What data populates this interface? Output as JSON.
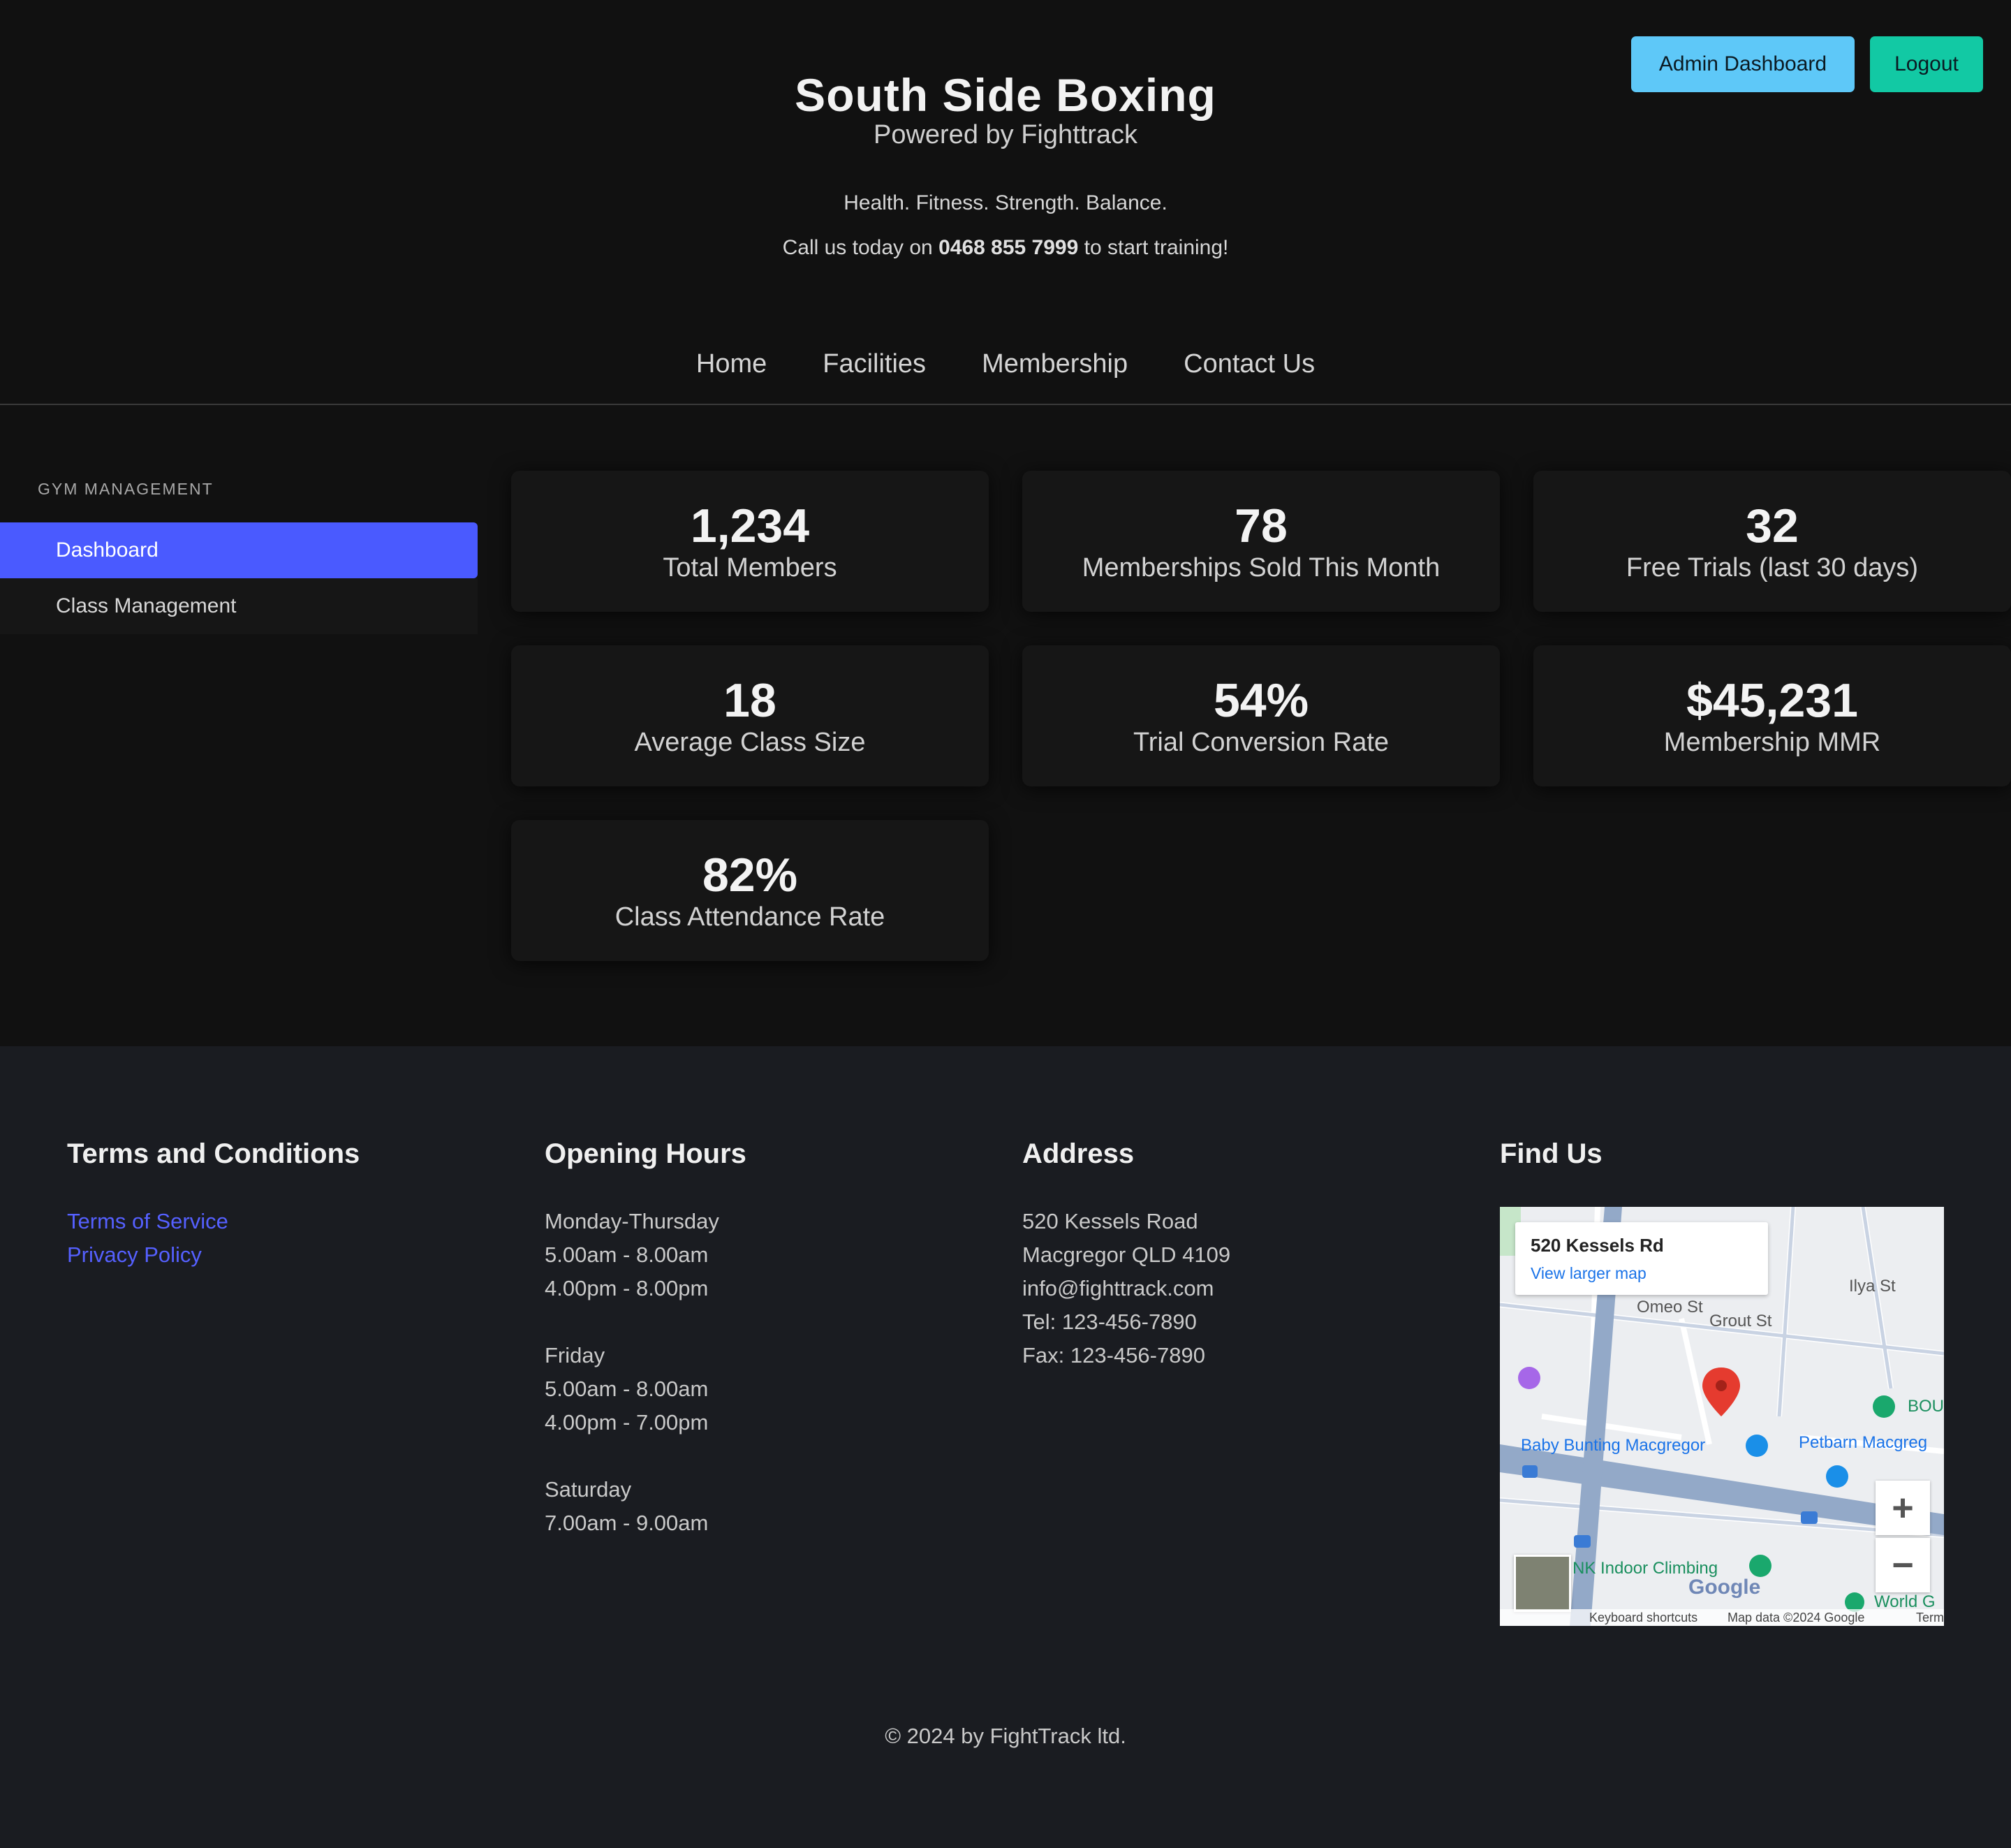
{
  "header": {
    "admin_button": "Admin Dashboard",
    "logout_button": "Logout",
    "title": "South Side Boxing",
    "subtitle": "Powered by Fighttrack",
    "tagline": "Health. Fitness. Strength. Balance.",
    "call_prefix": "Call us today on",
    "phone": "0468 855 7999",
    "call_suffix": "to start training!",
    "accent_admin": "#5ec8f8",
    "accent_logout": "#12c9a4"
  },
  "nav": {
    "items": [
      "Home",
      "Facilities",
      "Membership",
      "Contact Us"
    ]
  },
  "sidebar": {
    "heading": "GYM MANAGEMENT",
    "items": [
      {
        "label": "Dashboard",
        "active": true
      },
      {
        "label": "Class Management",
        "active": false
      }
    ],
    "active_color": "#4a5aff"
  },
  "stats": [
    {
      "value": "1,234",
      "label": "Total Members"
    },
    {
      "value": "78",
      "label": "Memberships Sold This Month"
    },
    {
      "value": "32",
      "label": "Free Trials (last 30 days)"
    },
    {
      "value": "18",
      "label": "Average Class Size"
    },
    {
      "value": "54%",
      "label": "Trial Conversion Rate"
    },
    {
      "value": "$45,231",
      "label": "Membership MMR"
    },
    {
      "value": "82%",
      "label": "Class Attendance Rate"
    }
  ],
  "footer": {
    "terms": {
      "heading": "Terms and Conditions",
      "links": [
        "Terms of Service",
        "Privacy Policy"
      ]
    },
    "hours": {
      "heading": "Opening Hours",
      "groups": [
        {
          "day": "Monday-Thursday",
          "times": [
            "5.00am - 8.00am",
            "4.00pm - 8.00pm"
          ]
        },
        {
          "day": "Friday",
          "times": [
            "5.00am - 8.00am",
            "4.00pm - 7.00pm"
          ]
        },
        {
          "day": "Saturday",
          "times": [
            "7.00am - 9.00am"
          ]
        }
      ]
    },
    "address": {
      "heading": "Address",
      "lines": [
        "520 Kessels Road",
        "Macgregor QLD 4109",
        "info@fighttrack.com",
        "Tel: 123-456-7890",
        "Fax: 123-456-7890"
      ]
    },
    "find_us": {
      "heading": "Find Us",
      "map_place": "520 Kessels Rd",
      "map_link": "View larger map",
      "map_labels": [
        "Baby Bunting Macgregor",
        "Petbarn Macgreg",
        "NK Indoor Climbing",
        "Omeo St",
        "Grout St",
        "Ilya St",
        "BOU",
        "World G"
      ],
      "map_attribution": [
        "Keyboard shortcuts",
        "Map data ©2024 Google",
        "Terms"
      ],
      "map_brand": "Google",
      "zoom_in": "+",
      "zoom_out": "−"
    },
    "copyright": "© 2024 by FightTrack ltd."
  }
}
